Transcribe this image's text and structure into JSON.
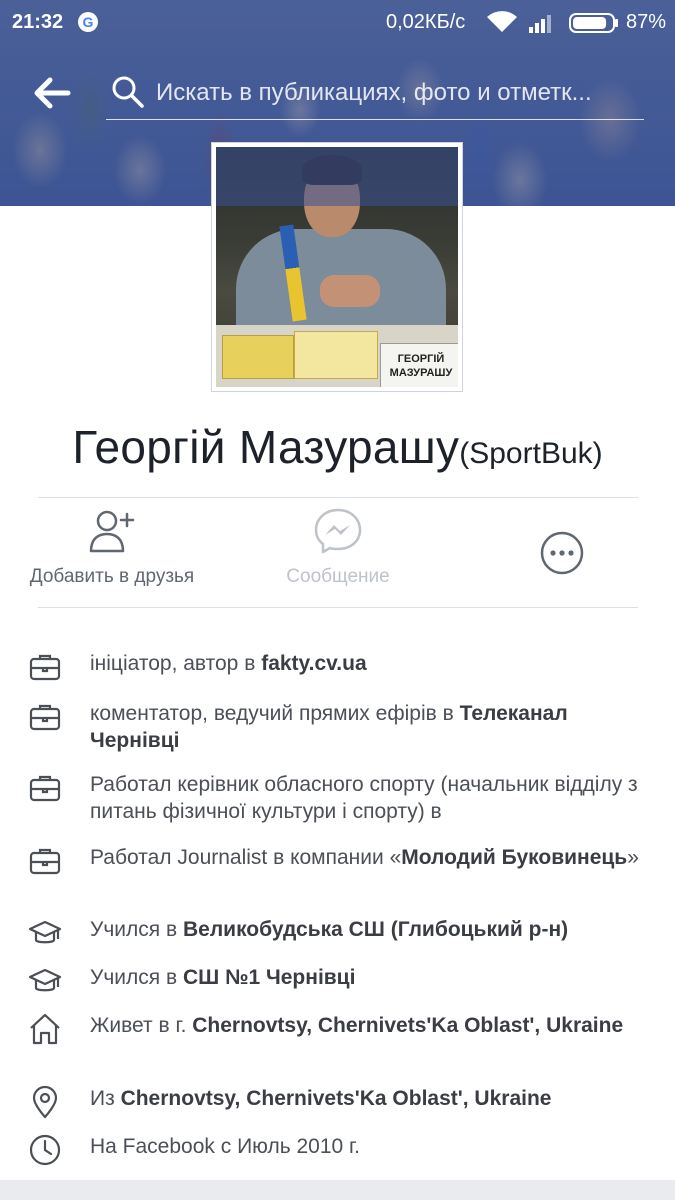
{
  "status_bar": {
    "time": "21:32",
    "speed": "0,02КБ/с",
    "battery_pct": "87%",
    "battery_level": 0.87
  },
  "search": {
    "placeholder": "Искать в публикациях, фото и отметк..."
  },
  "profile": {
    "name": "Георгій Мазурашу",
    "alt_name": "(SportBuk)",
    "photo_sign": "ГЕОРГІЙ МАЗУРАШУ"
  },
  "actions": {
    "add_friend": "Добавить в друзья",
    "message": "Сообщение"
  },
  "info": [
    {
      "icon": "briefcase-icon",
      "prefix": "ініціатор, автор в ",
      "bold": "fakty.cv.ua",
      "suffix": ""
    },
    {
      "icon": "briefcase-icon",
      "prefix": "коментатор, ведучий прямих ефірів в ",
      "bold": "Телеканал Чернівці",
      "suffix": ""
    },
    {
      "icon": "briefcase-icon",
      "prefix": "Работал керівник обласного спорту (начальник відділу з питань фізичної культури і спорту) в",
      "bold": "",
      "suffix": ""
    },
    {
      "icon": "briefcase-icon",
      "prefix": "Работал Journalist в компании «",
      "bold": "Молодий Буковинець",
      "suffix": "»"
    },
    {
      "icon": "graduation-cap-icon",
      "prefix": "Учился в ",
      "bold": "Великобудська СШ (Глибоцький р-н)",
      "suffix": ""
    },
    {
      "icon": "graduation-cap-icon",
      "prefix": "Учился в ",
      "bold": "СШ №1 Чернівці",
      "suffix": ""
    },
    {
      "icon": "home-icon",
      "prefix": "Живет в г. ",
      "bold": "Chernovtsy, Chernivets'Ka Oblast', Ukraine",
      "suffix": ""
    },
    {
      "icon": "location-pin-icon",
      "prefix": "Из ",
      "bold": "Chernovtsy, Chernivets'Ka Oblast', Ukraine",
      "suffix": ""
    },
    {
      "icon": "clock-icon",
      "prefix": "На Facebook с Июль 2010 г.",
      "bold": "",
      "suffix": ""
    }
  ],
  "colors": {
    "cover": "#4a5f98",
    "text_primary": "#1d2129",
    "text_secondary": "#4b4f56",
    "muted": "#bec3c9"
  }
}
